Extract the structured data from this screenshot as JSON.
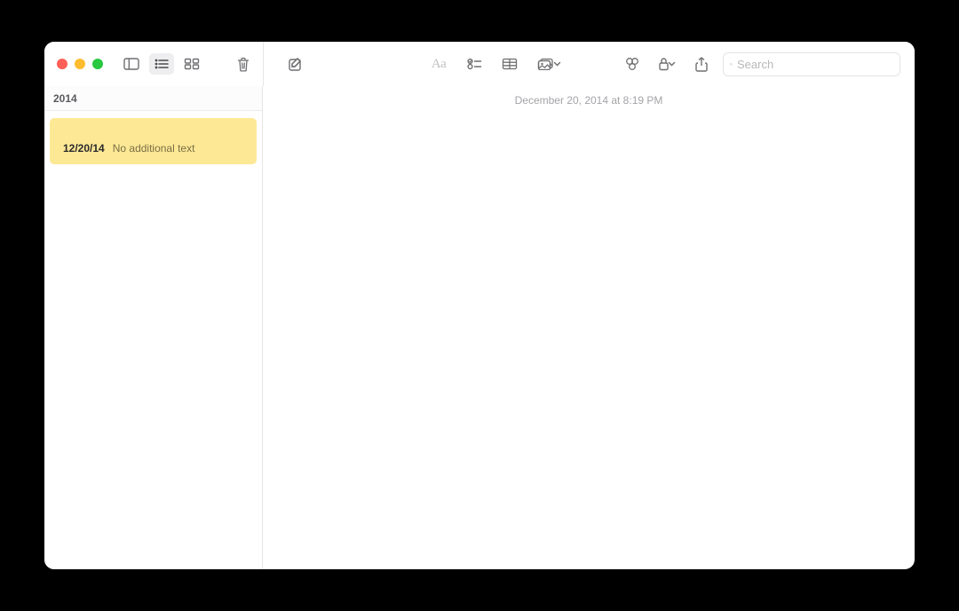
{
  "sidebar": {
    "section_header": "2014",
    "note": {
      "title_glyph": "",
      "date": "12/20/14",
      "snippet": "No additional text"
    }
  },
  "editor": {
    "timestamp": "December 20, 2014 at 8:19 PM",
    "body_glyph": ""
  },
  "search": {
    "placeholder": "Search"
  },
  "toolbar": {
    "compose_offset": "268px"
  }
}
